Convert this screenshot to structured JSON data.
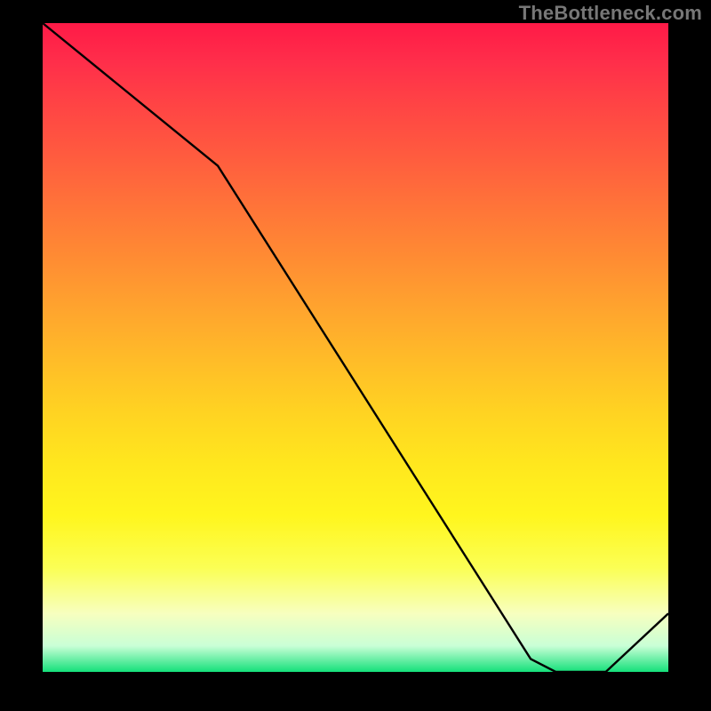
{
  "watermark": "TheBottleneck.com",
  "chart_data": {
    "type": "line",
    "title": "",
    "xlabel": "",
    "ylabel": "",
    "xlim": [
      0,
      100
    ],
    "ylim": [
      0,
      100
    ],
    "x": [
      0,
      28,
      78,
      82,
      90,
      100
    ],
    "values": [
      100,
      78,
      2,
      0,
      0,
      9
    ],
    "marker_region_x": [
      80,
      90
    ],
    "marker_region_y": 0,
    "background_gradient": {
      "top": "#ff1a47",
      "mid": "#ffe71e",
      "bottom": "#14e07a"
    },
    "line_color": "#000000",
    "marker_color": "#c9443d"
  }
}
